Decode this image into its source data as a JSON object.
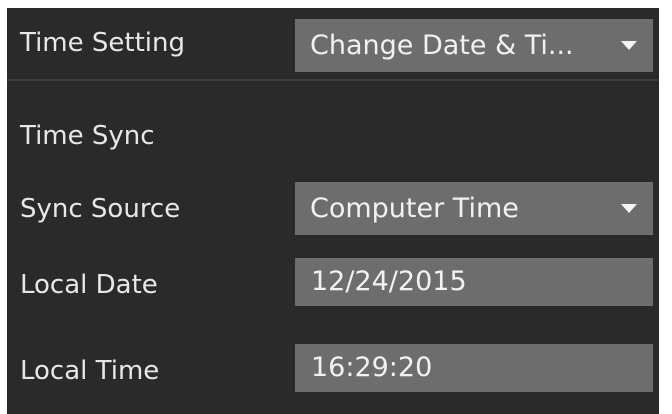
{
  "time_settings": {
    "time_setting_label": "Time Setting",
    "time_setting_value": "Change Date & Ti...",
    "time_sync_label": "Time Sync",
    "sync_source_label": "Sync Source",
    "sync_source_value": "Computer Time",
    "local_date_label": "Local Date",
    "local_date_value": "12/24/2015",
    "local_time_label": "Local Time",
    "local_time_value": "16:29:20"
  },
  "icons": {
    "dropdown": "chevron-down-icon"
  },
  "colors": {
    "panel_background": "#2a2a2a",
    "control_background": "#6d6d6d",
    "text": "#e7e7e7",
    "divider": "#3b3b3b"
  }
}
